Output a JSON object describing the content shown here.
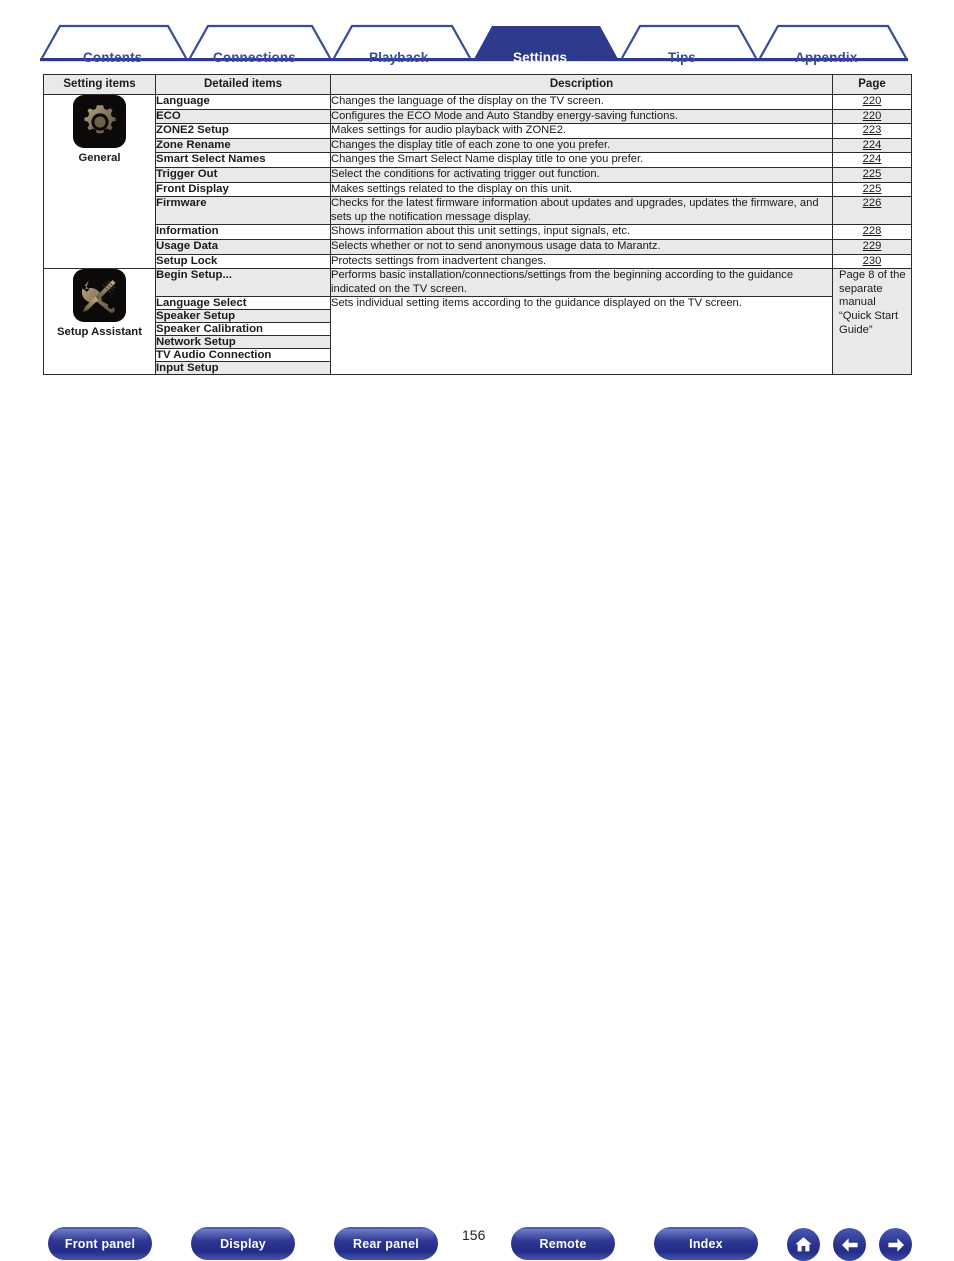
{
  "nav": {
    "tabs": [
      {
        "label": "Contents",
        "active": false
      },
      {
        "label": "Connections",
        "active": false
      },
      {
        "label": "Playback",
        "active": false
      },
      {
        "label": "Settings",
        "active": true
      },
      {
        "label": "Tips",
        "active": false
      },
      {
        "label": "Appendix",
        "active": false
      }
    ]
  },
  "table": {
    "headers": {
      "setting": "Setting items",
      "detail": "Detailed items",
      "description": "Description",
      "page": "Page"
    },
    "groups": [
      {
        "name": "General",
        "icon": "gear-icon",
        "rows": [
          {
            "detail": "Language",
            "desc": "Changes the language of the display on the TV screen.",
            "page": "220"
          },
          {
            "detail": "ECO",
            "desc": "Configures the ECO Mode and Auto Standby energy-saving functions.",
            "page": "220"
          },
          {
            "detail": "ZONE2 Setup",
            "desc": "Makes settings for audio playback with ZONE2.",
            "page": "223"
          },
          {
            "detail": "Zone Rename",
            "desc": "Changes the display title of each zone to one you prefer.",
            "page": "224"
          },
          {
            "detail": "Smart Select Names",
            "desc": "Changes the Smart Select Name display title to one you prefer.",
            "page": "224"
          },
          {
            "detail": "Trigger Out",
            "desc": "Select the conditions for activating trigger out function.",
            "page": "225"
          },
          {
            "detail": "Front Display",
            "desc": "Makes settings related to the display on this unit.",
            "page": "225"
          },
          {
            "detail": "Firmware",
            "desc": "Checks for the latest firmware information about updates and upgrades, updates the firmware, and sets up the notification message display.",
            "page": "226"
          },
          {
            "detail": "Information",
            "desc": "Shows information about this unit settings, input signals, etc.",
            "page": "228"
          },
          {
            "detail": "Usage Data",
            "desc": "Selects whether or not to send anonymous usage data to Marantz.",
            "page": "229"
          },
          {
            "detail": "Setup Lock",
            "desc": "Protects settings from inadvertent changes.",
            "page": "230"
          }
        ]
      },
      {
        "name": "Setup Assistant",
        "icon": "wrench-screwdriver-icon",
        "page_note": "Page 8 of the separate manual “Quick Start Guide”",
        "rows": [
          {
            "detail": "Begin Setup...",
            "desc": "Performs basic installation/connections/settings from the beginning according to the guidance indicated on the TV screen."
          },
          {
            "detail": "Language Select",
            "desc": "Sets individual setting items according to the guidance displayed on the TV screen."
          },
          {
            "detail": "Speaker Setup",
            "desc": ""
          },
          {
            "detail": "Speaker Calibration",
            "desc": ""
          },
          {
            "detail": "Network Setup",
            "desc": ""
          },
          {
            "detail": "TV Audio Connection",
            "desc": ""
          },
          {
            "detail": "Input Setup",
            "desc": ""
          }
        ]
      }
    ]
  },
  "footer": {
    "page_number": "156",
    "buttons": [
      {
        "label": "Front panel"
      },
      {
        "label": "Display"
      },
      {
        "label": "Rear panel"
      },
      {
        "label": "Remote"
      },
      {
        "label": "Index"
      }
    ],
    "icons": [
      {
        "name": "home-icon"
      },
      {
        "name": "arrow-left-icon"
      },
      {
        "name": "arrow-right-icon"
      }
    ]
  },
  "colors": {
    "brand_blue": "#3a4a9f",
    "tab_active": "#2e3a8c",
    "row_gray": "#e9e9e9"
  }
}
